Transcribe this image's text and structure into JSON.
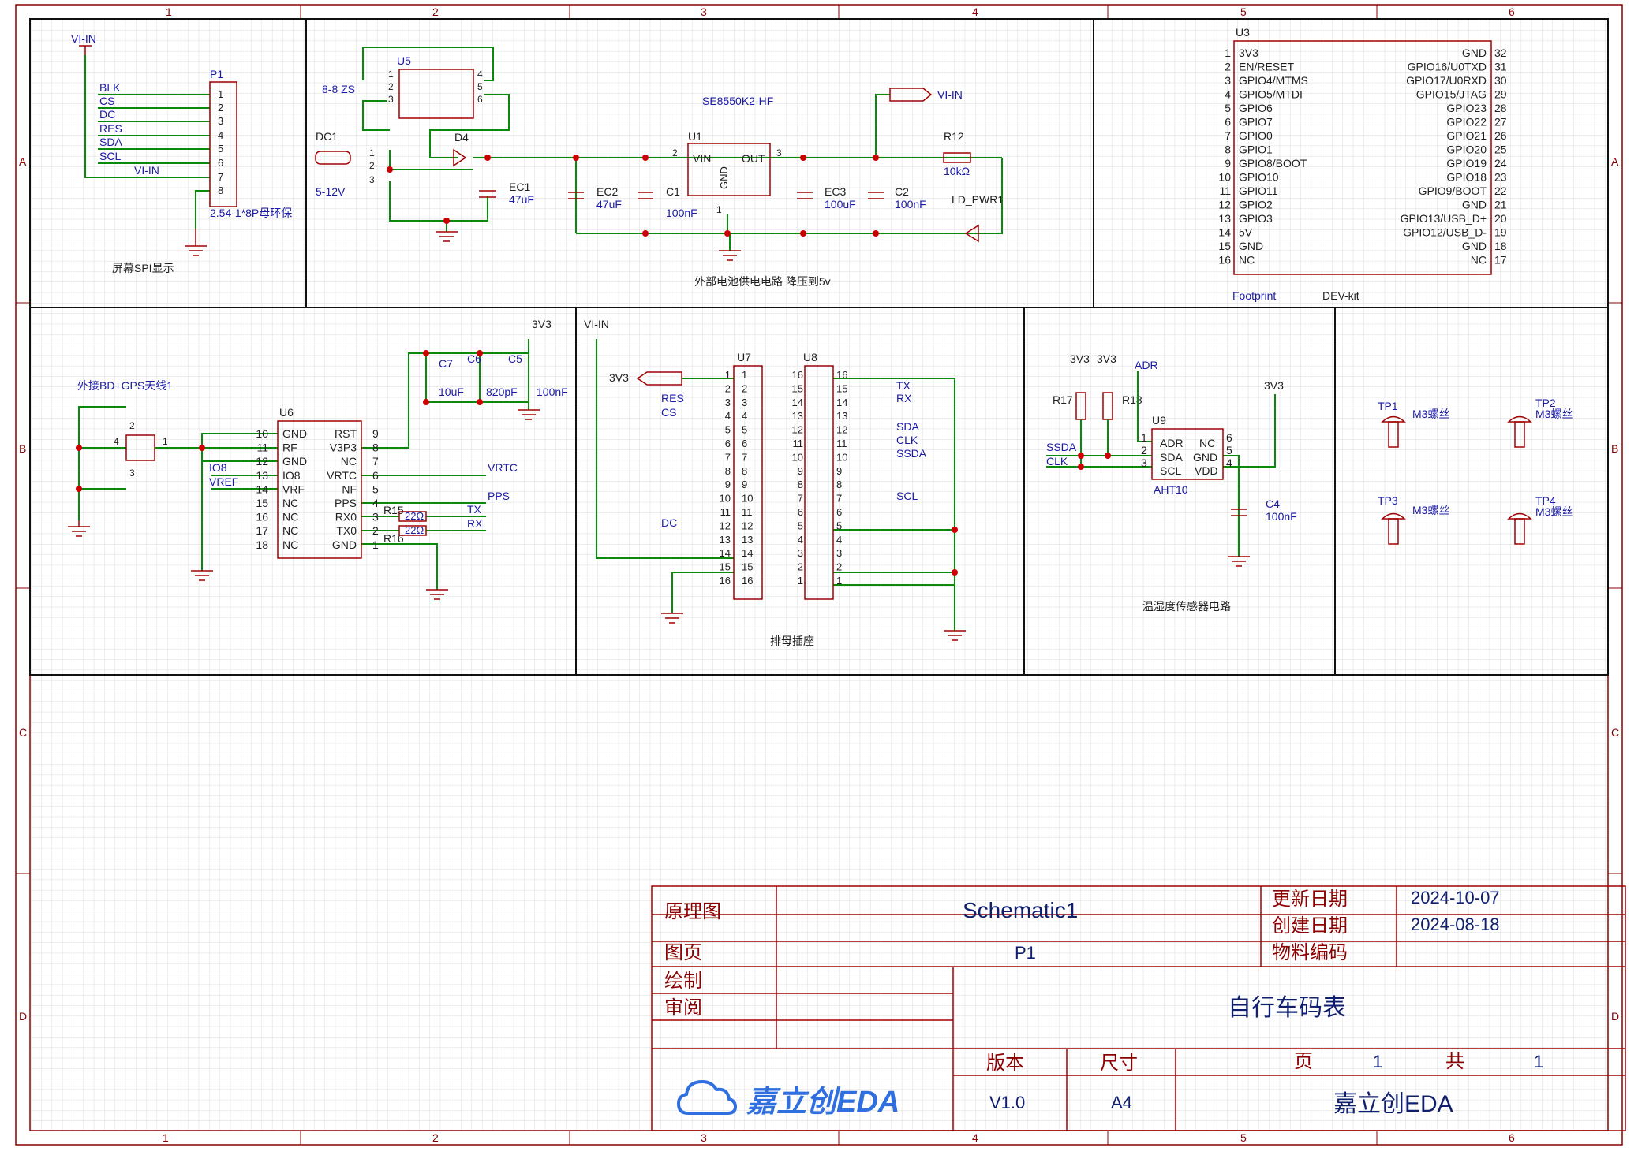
{
  "border": {
    "columns": [
      "1",
      "2",
      "3",
      "4",
      "5",
      "6"
    ],
    "rows": [
      "A",
      "B",
      "C",
      "D"
    ]
  },
  "colors": {
    "grid": "#dcdcdc",
    "frame": "#8b0000",
    "wire": "#0a8a0a",
    "component": "#a00000",
    "label": "#1a1aa6",
    "text": "#1f1f1f"
  },
  "sections": {
    "spi_display": {
      "caption": "屏幕SPI显示",
      "netflag": "VI-IN",
      "designator": "P1",
      "value": "2.54-1*8P母环保",
      "pin_nets": [
        "BLK",
        "CS",
        "DC",
        "RES",
        "SDA",
        "SCL",
        "VI-IN"
      ],
      "pins": [
        "1",
        "2",
        "3",
        "4",
        "5",
        "6",
        "7",
        "8"
      ]
    },
    "power": {
      "caption": "外部电池供电电路 降压到5v",
      "u5_designator": "U5",
      "u5_value": "8-8 ZS",
      "u5_pins": [
        "1",
        "2",
        "3",
        "4",
        "5",
        "6"
      ],
      "dc1_designator": "DC1",
      "dc1_value": "5-12V",
      "dc1_pins": [
        "1",
        "2",
        "3"
      ],
      "d4_designator": "D4",
      "ec1_designator": "EC1",
      "ec1_value": "47uF",
      "u1_designator": "U1",
      "u1_value": "SE8550K2-HF",
      "u1_pin_vin": "VIN",
      "u1_pin_out": "OUT",
      "u1_pin_gnd": "GND",
      "u1_pins": [
        "2",
        "3",
        "1"
      ],
      "ec2_designator": "EC2",
      "ec2_value": "47uF",
      "c1_designator": "C1",
      "c1_value": "100nF",
      "ec3_designator": "EC3",
      "ec3_value": "100uF",
      "c2_designator": "C2",
      "c2_value": "100nF",
      "r12_designator": "R12",
      "r12_value": "10kΩ",
      "led_designator": "LD_PWR1",
      "netflag": "VI-IN"
    },
    "mcu": {
      "designator": "U3",
      "footprint_label": "Footprint",
      "value": "DEV-kit",
      "left_pins": [
        {
          "num": "1",
          "name": "3V3"
        },
        {
          "num": "2",
          "name": "EN/RESET"
        },
        {
          "num": "3",
          "name": "GPIO4/MTMS"
        },
        {
          "num": "4",
          "name": "GPIO5/MTDI"
        },
        {
          "num": "5",
          "name": "GPIO6"
        },
        {
          "num": "6",
          "name": "GPIO7"
        },
        {
          "num": "7",
          "name": "GPIO0"
        },
        {
          "num": "8",
          "name": "GPIO1"
        },
        {
          "num": "9",
          "name": "GPIO8/BOOT"
        },
        {
          "num": "10",
          "name": "GPIO10"
        },
        {
          "num": "11",
          "name": "GPIO11"
        },
        {
          "num": "12",
          "name": "GPIO2"
        },
        {
          "num": "13",
          "name": "GPIO3"
        },
        {
          "num": "14",
          "name": "5V"
        },
        {
          "num": "15",
          "name": "GND"
        },
        {
          "num": "16",
          "name": "NC"
        }
      ],
      "right_pins": [
        {
          "num": "32",
          "name": "GND"
        },
        {
          "num": "31",
          "name": "GPIO16/U0TXD"
        },
        {
          "num": "30",
          "name": "GPIO17/U0RXD"
        },
        {
          "num": "29",
          "name": "GPIO15/JTAG"
        },
        {
          "num": "28",
          "name": "GPIO23"
        },
        {
          "num": "27",
          "name": "GPIO22"
        },
        {
          "num": "26",
          "name": "GPIO21"
        },
        {
          "num": "25",
          "name": "GPIO20"
        },
        {
          "num": "24",
          "name": "GPIO19"
        },
        {
          "num": "23",
          "name": "GPIO18"
        },
        {
          "num": "22",
          "name": "GPIO9/BOOT"
        },
        {
          "num": "21",
          "name": "GND"
        },
        {
          "num": "20",
          "name": "GPIO13/USB_D+"
        },
        {
          "num": "19",
          "name": "GPIO12/USB_D-"
        },
        {
          "num": "18",
          "name": "GND"
        },
        {
          "num": "17",
          "name": "NC"
        }
      ]
    },
    "gps": {
      "antenna_label": "外接BD+GPS天线1",
      "antenna_pins": [
        "2",
        "4",
        "3",
        "1"
      ],
      "designator": "U6",
      "left_pins": [
        {
          "num": "10",
          "name": "GND"
        },
        {
          "num": "11",
          "name": "RF"
        },
        {
          "num": "12",
          "name": "GND"
        },
        {
          "num": "13",
          "name": "IO8"
        },
        {
          "num": "14",
          "name": "VRF"
        },
        {
          "num": "15",
          "name": "NC"
        },
        {
          "num": "16",
          "name": "NC"
        },
        {
          "num": "17",
          "name": "NC"
        },
        {
          "num": "18",
          "name": "NC"
        }
      ],
      "right_pins": [
        {
          "num": "9",
          "name": "RST"
        },
        {
          "num": "8",
          "name": "V3P3"
        },
        {
          "num": "7",
          "name": "NC"
        },
        {
          "num": "6",
          "name": "VRTC"
        },
        {
          "num": "5",
          "name": "NF"
        },
        {
          "num": "4",
          "name": "PPS"
        },
        {
          "num": "3",
          "name": "RX0"
        },
        {
          "num": "2",
          "name": "TX0"
        },
        {
          "num": "1",
          "name": "GND"
        }
      ],
      "nets": {
        "io8": "IO8",
        "vref": "VREF",
        "vrtc": "VRTC",
        "pps": "PPS",
        "tx": "TX",
        "rx": "RX",
        "v33": "3V3"
      },
      "c7_designator": "C7",
      "c7_value": "10uF",
      "c6_designator": "C6",
      "c6_value": "820pF",
      "c5_designator": "C5",
      "c5_value": "100nF",
      "r15_designator": "R15",
      "r16_designator": "R16",
      "r_value": "22Ω"
    },
    "header": {
      "caption": "排母插座",
      "vin": "VI-IN",
      "v33": "3V3",
      "u7_designator": "U7",
      "u8_designator": "U8",
      "u7_nets": [
        "RES",
        "CS",
        "DC"
      ],
      "u8_nets": [
        "TX",
        "RX",
        "SDA",
        "CLK",
        "SSDA",
        "SCL"
      ],
      "pins": [
        "1",
        "2",
        "3",
        "4",
        "5",
        "6",
        "7",
        "8",
        "9",
        "10",
        "11",
        "12",
        "13",
        "14",
        "15",
        "16"
      ],
      "u8_pins": [
        "16",
        "15",
        "14",
        "13",
        "12",
        "11",
        "10",
        "9",
        "8",
        "7",
        "6",
        "5",
        "4",
        "3",
        "2",
        "1"
      ]
    },
    "sensor": {
      "caption": "温湿度传感器电路",
      "designator": "U9",
      "value": "AHT10",
      "left_pins": [
        {
          "num": "1",
          "name": "ADR"
        },
        {
          "num": "2",
          "name": "SDA"
        },
        {
          "num": "3",
          "name": "SCL"
        }
      ],
      "right_pins": [
        {
          "num": "6",
          "name": "NC"
        },
        {
          "num": "5",
          "name": "GND"
        },
        {
          "num": "4",
          "name": "VDD"
        }
      ],
      "r17": "R17",
      "r18": "R18",
      "v33a": "3V3",
      "v33b": "3V3",
      "v33c": "3V3",
      "adr": "ADR",
      "ssda": "SSDA",
      "clk": "CLK",
      "c4_designator": "C4",
      "c4_value": "100nF"
    },
    "mounting": {
      "holes": [
        {
          "designator": "TP1",
          "value": "M3螺丝"
        },
        {
          "designator": "TP2",
          "value": "M3螺丝"
        },
        {
          "designator": "TP3",
          "value": "M3螺丝"
        },
        {
          "designator": "TP4",
          "value": "M3螺丝"
        }
      ]
    }
  },
  "title_block": {
    "schematic_label": "原理图",
    "schematic_value": "Schematic1",
    "updated_label": "更新日期",
    "updated_value": "2024-10-07",
    "created_label": "创建日期",
    "created_value": "2024-08-18",
    "page_label": "图页",
    "page_value": "P1",
    "material_label": "物料编码",
    "material_value": "",
    "drawn_label": "绘制",
    "review_label": "审阅",
    "project_title": "自行车码表",
    "version_label": "版本",
    "version_value": "V1.0",
    "size_label": "尺寸",
    "size_value": "A4",
    "sheet_label": "页",
    "sheet_value": "1",
    "total_label": "共",
    "total_value": "1",
    "logo_text": "嘉立创EDA",
    "company": "嘉立创EDA"
  }
}
